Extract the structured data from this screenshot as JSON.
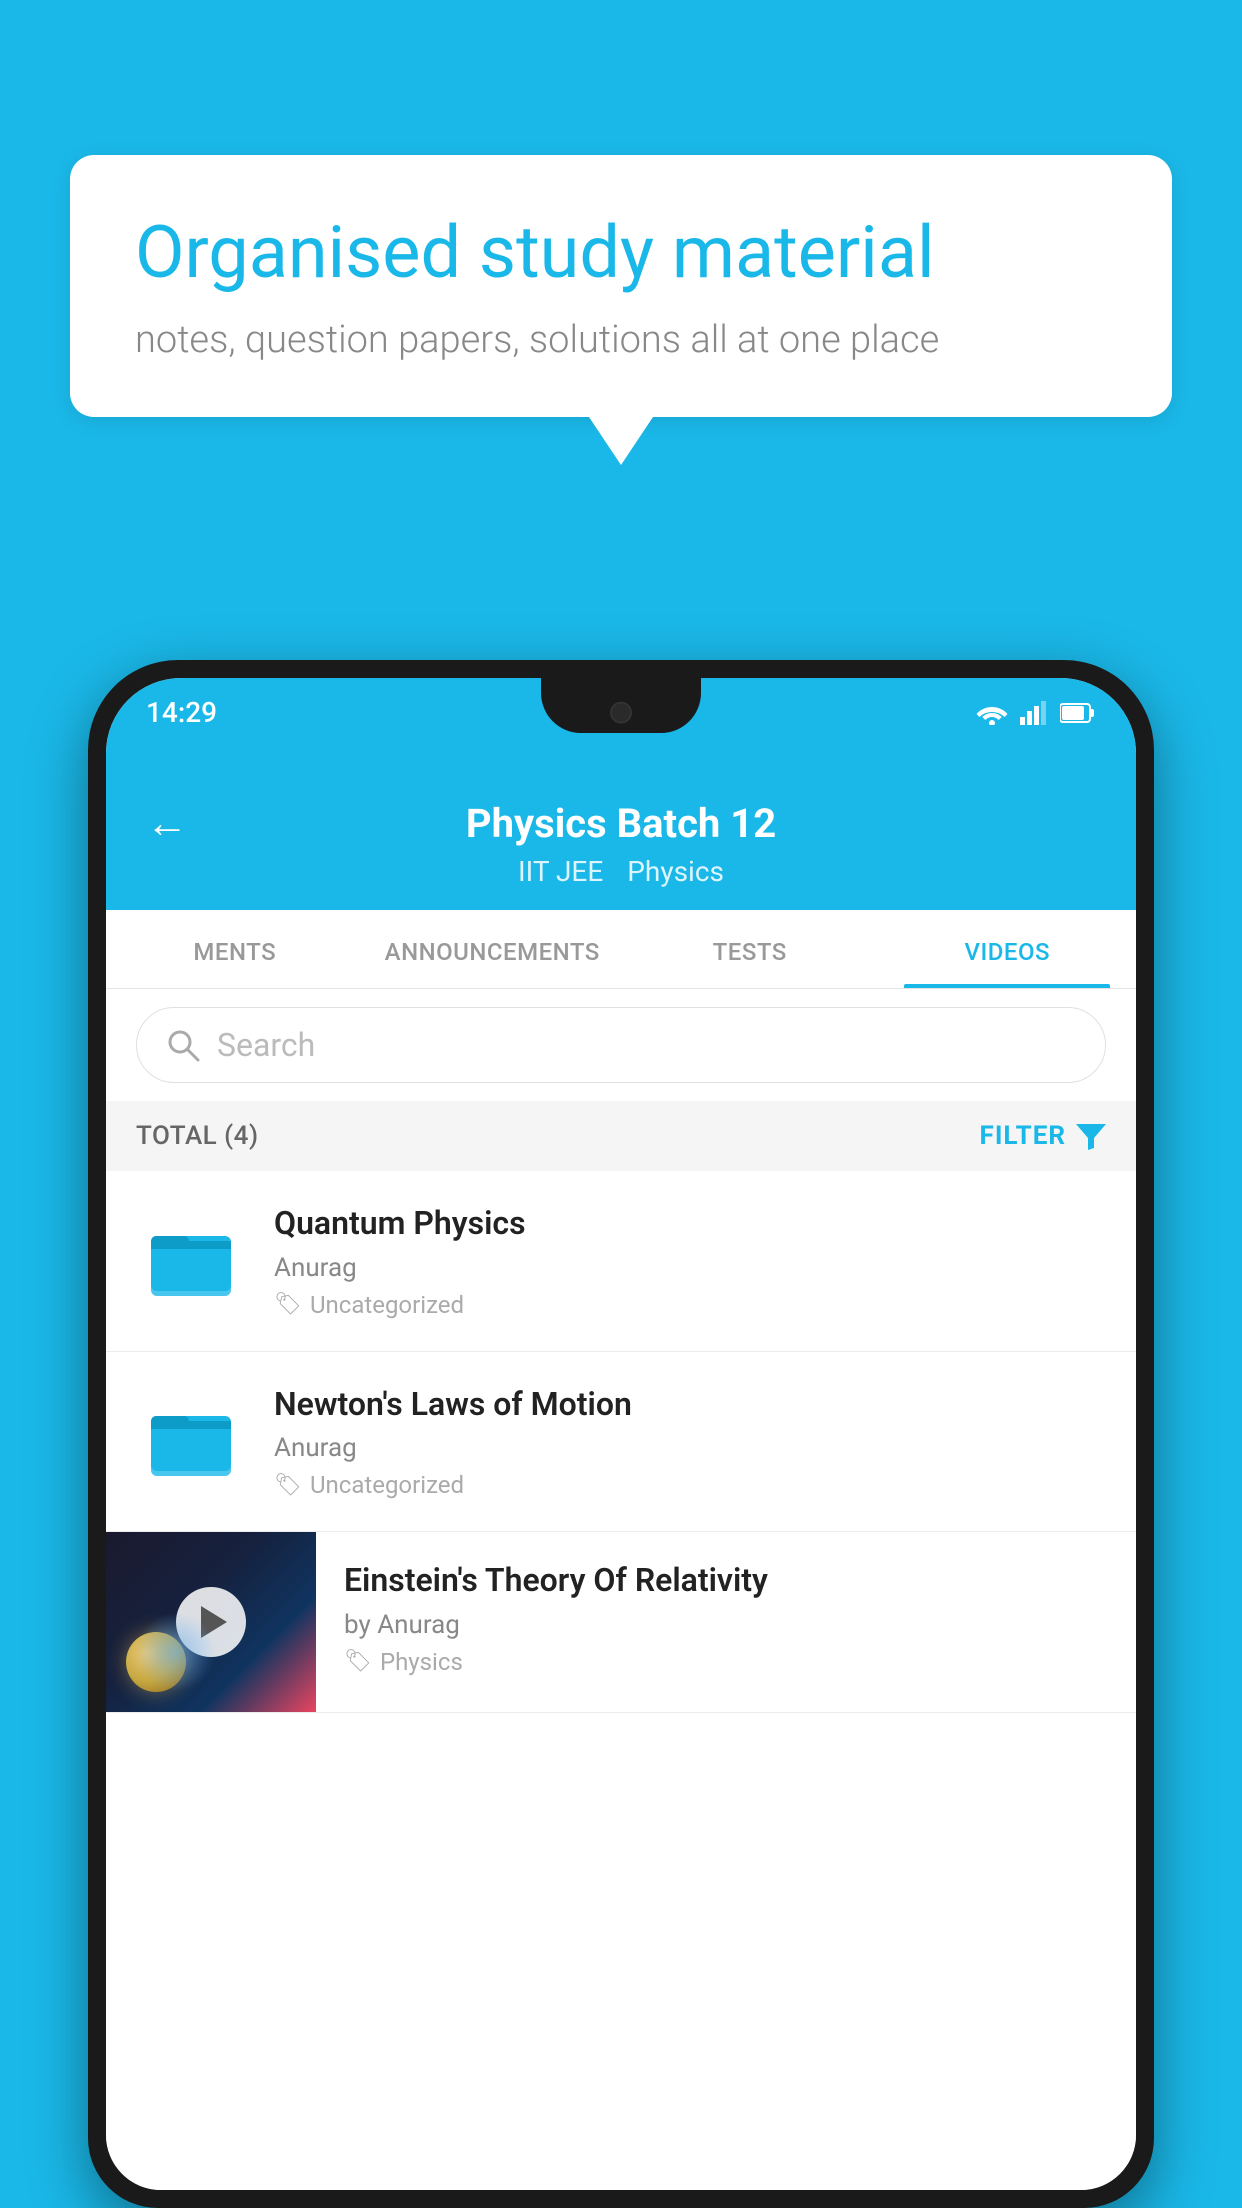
{
  "page": {
    "background_color": "#1ab8e8"
  },
  "speech_bubble": {
    "title": "Organised study material",
    "subtitle": "notes, question papers, solutions all at one place"
  },
  "status_bar": {
    "time": "14:29",
    "wifi": "wifi-icon",
    "signal": "signal-icon",
    "battery": "battery-icon"
  },
  "app_header": {
    "title": "Physics Batch 12",
    "tag1": "IIT JEE",
    "tag2": "Physics",
    "back_label": "←"
  },
  "tabs": [
    {
      "id": "ments",
      "label": "MENTS",
      "active": false
    },
    {
      "id": "announcements",
      "label": "ANNOUNCEMENTS",
      "active": false
    },
    {
      "id": "tests",
      "label": "TESTS",
      "active": false
    },
    {
      "id": "videos",
      "label": "VIDEOS",
      "active": true
    }
  ],
  "search": {
    "placeholder": "Search"
  },
  "filter_bar": {
    "total_label": "TOTAL (4)",
    "filter_label": "FILTER"
  },
  "video_items": [
    {
      "id": "quantum",
      "title": "Quantum Physics",
      "author": "Anurag",
      "tag": "Uncategorized",
      "type": "folder"
    },
    {
      "id": "newton",
      "title": "Newton's Laws of Motion",
      "author": "Anurag",
      "tag": "Uncategorized",
      "type": "folder"
    },
    {
      "id": "einstein",
      "title": "Einstein's Theory Of Relativity",
      "author": "by Anurag",
      "tag": "Physics",
      "type": "video"
    }
  ]
}
